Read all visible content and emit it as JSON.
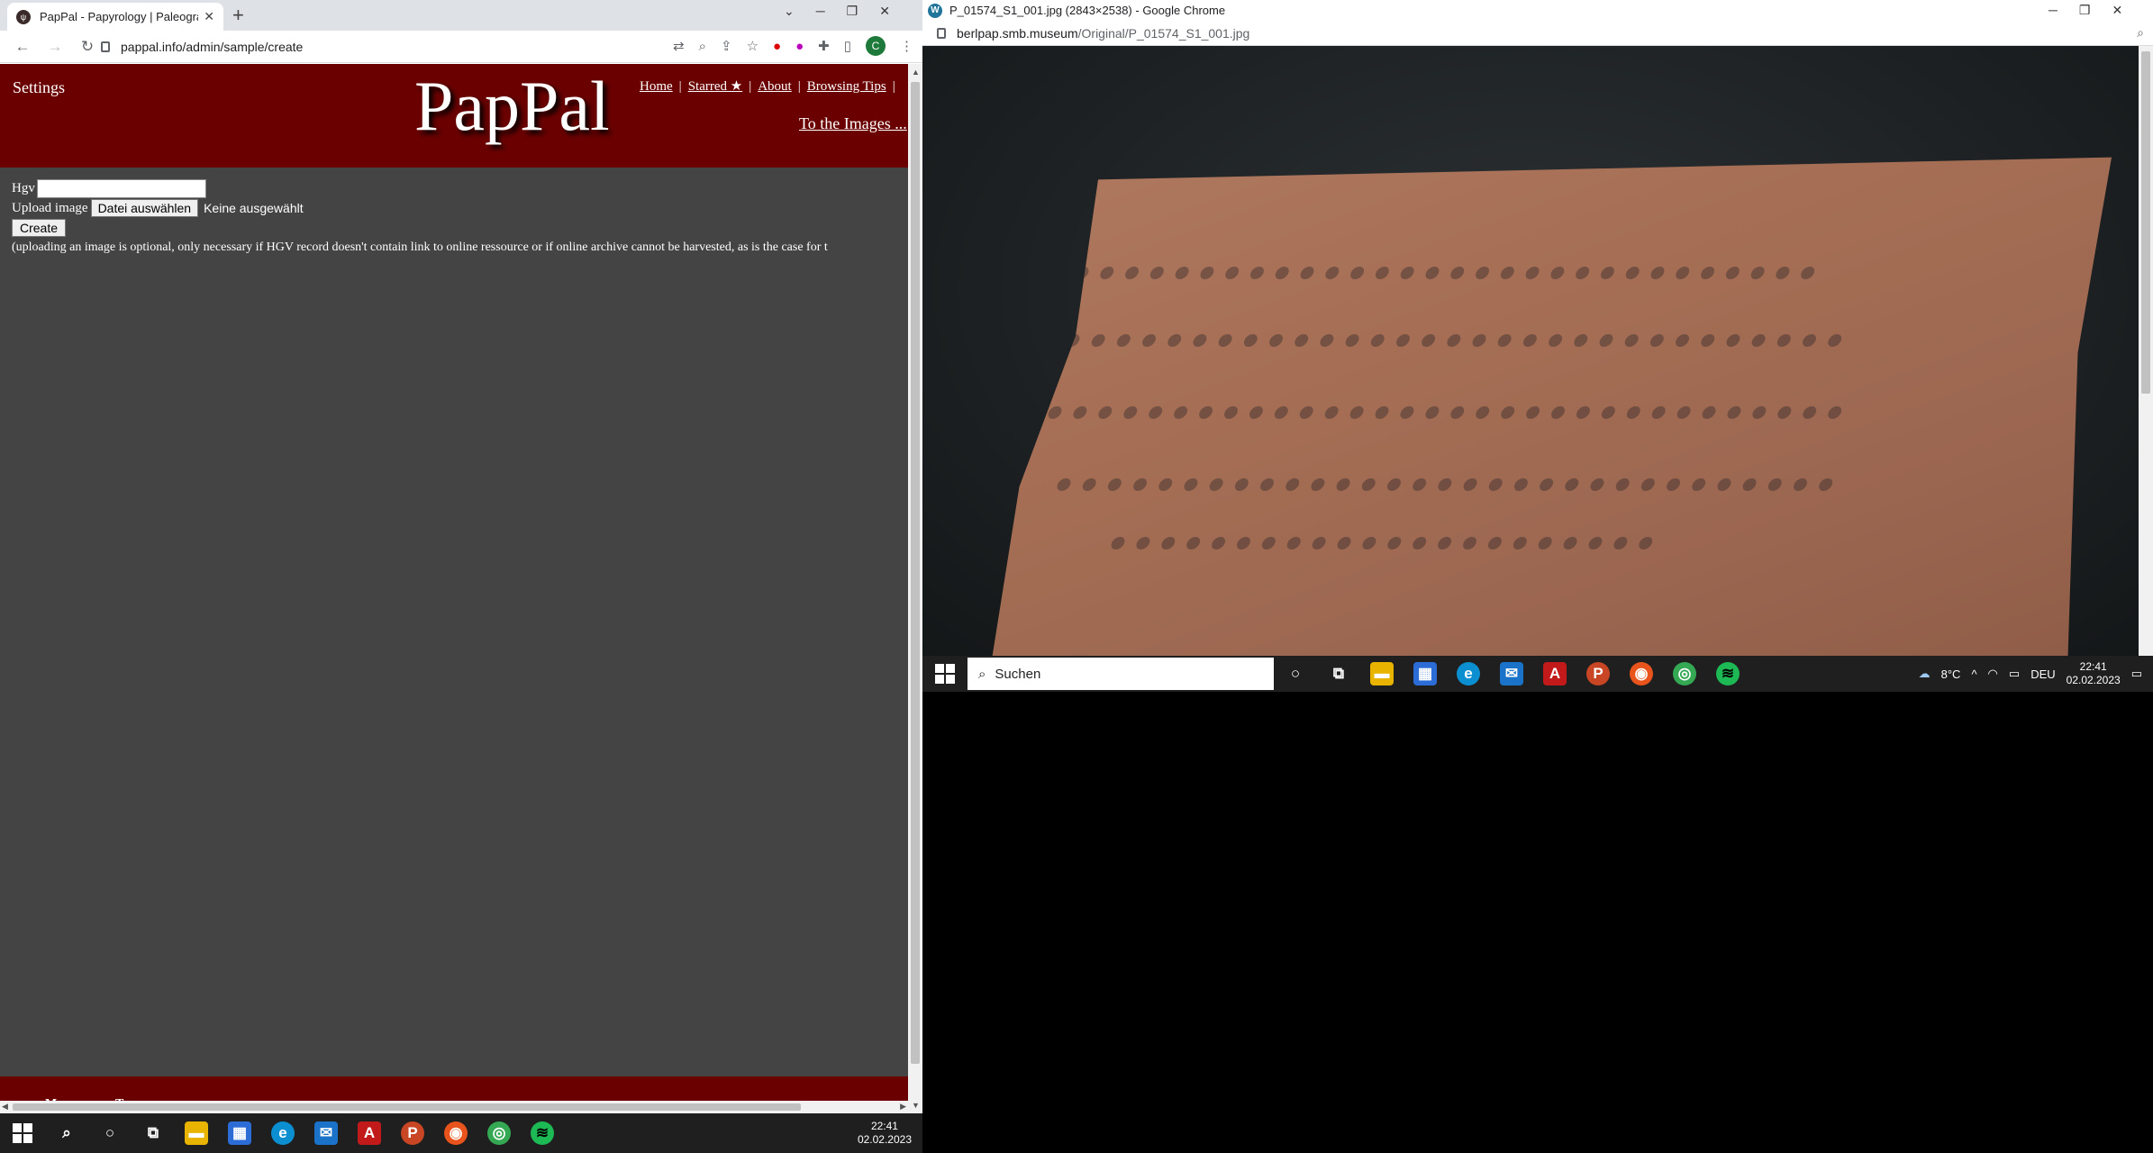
{
  "left_browser": {
    "tab_title": "PapPal - Papyrology | Paleograph",
    "url": "pappal.info/admin/sample/create",
    "avatar_letter": "C",
    "page": {
      "settings": "Settings",
      "logo": "PapPal",
      "nav": [
        "Home",
        "Starred ★",
        "About",
        "Browsing Tips"
      ],
      "nav_sep": "|",
      "to_images": "To the Images ...",
      "hgv_label": "Hgv",
      "upload_label": "Upload image",
      "file_button": "Datei auswählen",
      "file_status": "Keine ausgewählt",
      "create_button": "Create",
      "note": "(uploading an image is optional, only necessary if HGV record doesn't contain link to online ressource or if online archive cannot be harvested, as is the case for t",
      "footer": "Materiale Textkulturen"
    }
  },
  "left_taskbar": {
    "time": "22:41",
    "date": "02.02.2023"
  },
  "right_window": {
    "title": "P_01574_S1_001.jpg (2843×2538) - Google Chrome",
    "url_host": "berlpap.smb.museum",
    "url_path": "/Original/P_01574_S1_001.jpg"
  },
  "right_taskbar": {
    "search_placeholder": "Suchen",
    "weather": "8°C",
    "lang": "DEU",
    "time": "22:41",
    "date": "02.02.2023"
  },
  "colors": {
    "banner": "#6b0000",
    "page_bg": "#444444",
    "taskbar": "#1f1f1f"
  }
}
